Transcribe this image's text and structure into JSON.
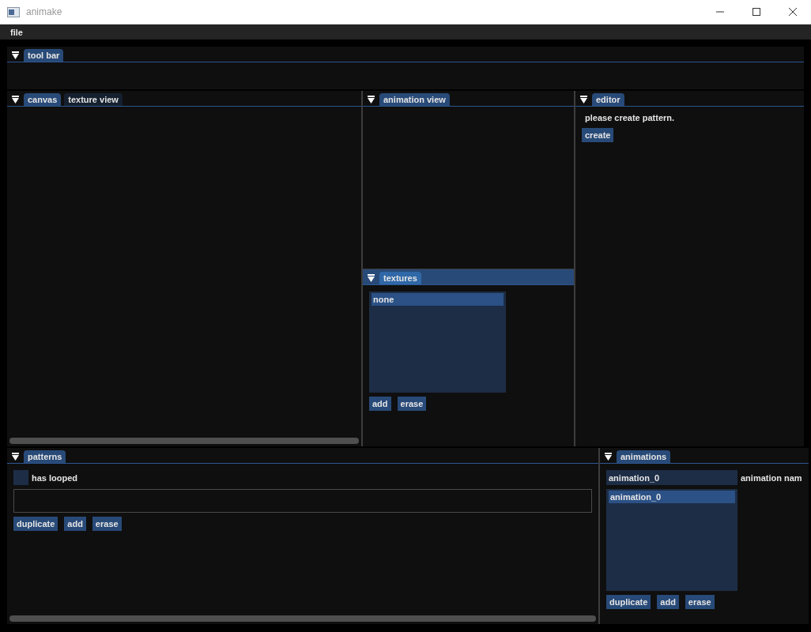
{
  "window": {
    "title": "animake"
  },
  "menu": [
    "file"
  ],
  "toolbar": {
    "focused": false,
    "tabs": [
      {
        "label": "tool bar",
        "selected": true
      }
    ]
  },
  "canvas": {
    "focused": false,
    "tabs": [
      {
        "label": "canvas",
        "selected": true
      },
      {
        "label": "texture view",
        "selected": false
      }
    ]
  },
  "animation_view": {
    "focused": false,
    "tabs": [
      {
        "label": "animation view",
        "selected": true
      }
    ]
  },
  "textures": {
    "focused": true,
    "tabs": [
      {
        "label": "textures",
        "selected": true
      }
    ],
    "items": [
      {
        "label": "none",
        "selected": true
      }
    ],
    "buttons": [
      "add",
      "erase"
    ]
  },
  "editor": {
    "focused": false,
    "tabs": [
      {
        "label": "editor",
        "selected": true
      }
    ],
    "message": "please create pattern.",
    "buttons": [
      "create"
    ]
  },
  "patterns": {
    "focused": false,
    "tabs": [
      {
        "label": "patterns",
        "selected": true
      }
    ],
    "has_looped": {
      "label": "has looped",
      "checked": false
    },
    "buttons": [
      "duplicate",
      "add",
      "erase"
    ]
  },
  "animations": {
    "focused": false,
    "tabs": [
      {
        "label": "animations",
        "selected": true
      }
    ],
    "name_field": {
      "value": "animation_0",
      "label": "animation nam"
    },
    "items": [
      {
        "label": "animation_0",
        "selected": true
      }
    ],
    "buttons": [
      "duplicate",
      "add",
      "erase"
    ]
  }
}
